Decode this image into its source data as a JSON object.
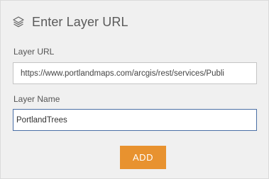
{
  "header": {
    "title": "Enter Layer URL",
    "icon": "layers-icon"
  },
  "form": {
    "url_label": "Layer URL",
    "url_value": "https://www.portlandmaps.com/arcgis/rest/services/Publi",
    "name_label": "Layer Name",
    "name_value": "PortlandTrees"
  },
  "actions": {
    "add_label": "ADD",
    "add_color": "#e8922f"
  }
}
